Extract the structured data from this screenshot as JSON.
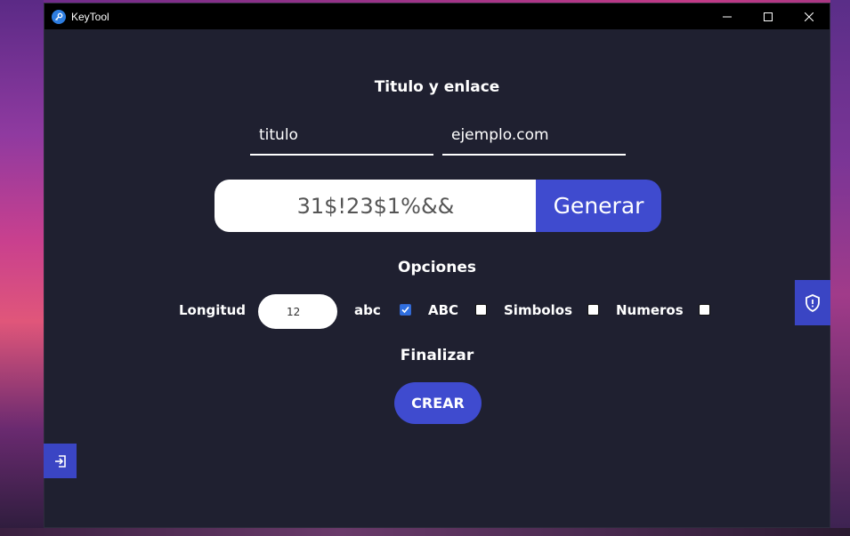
{
  "window": {
    "title": "KeyTool"
  },
  "section_link": {
    "heading": "Titulo y enlace",
    "title_value": "titulo",
    "link_value": "ejemplo.com"
  },
  "generator": {
    "password_value": "31$!23$1%&&",
    "generate_label": "Generar"
  },
  "options": {
    "heading": "Opciones",
    "length_label": "Longitud",
    "length_value": "12",
    "lower_label": "abc",
    "lower_checked": true,
    "upper_label": "ABC",
    "upper_checked": false,
    "symbols_label": "Simbolos",
    "symbols_checked": false,
    "numbers_label": "Numeros",
    "numbers_checked": false
  },
  "finish": {
    "heading": "Finalizar",
    "create_label": "CREAR"
  },
  "side_buttons": {
    "right_icon": "shield-icon",
    "left_icon": "logout-icon"
  },
  "colors": {
    "background": "#1f2030",
    "accent": "#3f4bcf",
    "titlebar": "#000000"
  }
}
